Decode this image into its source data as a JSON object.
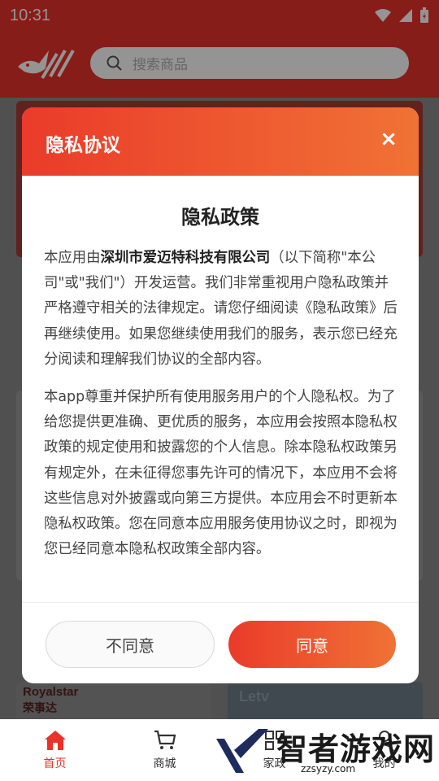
{
  "status_bar": {
    "time": "10:31"
  },
  "search": {
    "placeholder": "搜索商品"
  },
  "brands": {
    "left": "Royalstar",
    "left_cn": "荣事达",
    "right": "Letv"
  },
  "bottom_nav": {
    "items": [
      {
        "label": "首页"
      },
      {
        "label": "商城"
      },
      {
        "label": "家政"
      },
      {
        "label": "我的"
      }
    ]
  },
  "dialog": {
    "title": "隐私协议",
    "close_icon": "×",
    "policy_title": "隐私政策",
    "para1_prefix": "本应用由",
    "para1_company": "深圳市爱迈特科技有限公司",
    "para1_rest": "（以下简称\"本公司\"或\"我们\"）开发运营。我们非常重视用户隐私政策并严格遵守相关的法律规定。请您仔细阅读《隐私政策》后再继续使用。如果您继续使用我们的服务，表示您已经充分阅读和理解我们协议的全部内容。",
    "para2": "本app尊重并保护所有使用服务用户的个人隐私权。为了给您提供更准确、更优质的服务，本应用会按照本隐私权政策的规定使用和披露您的个人信息。除本隐私权政策另有规定外，在未征得您事先许可的情况下，本应用不会将这些信息对外披露或向第三方提供。本应用会不时更新本隐私权政策。您在同意本应用服务使用协议之时，即视为您已经同意本隐私权政策全部内容。",
    "disagree_label": "不同意",
    "agree_label": "同意"
  },
  "watermark": {
    "text": "智者游戏网",
    "url": "zzsyzy.com"
  },
  "colors": {
    "accent": "#e8322a",
    "accent_gradient_end": "#f07235"
  }
}
